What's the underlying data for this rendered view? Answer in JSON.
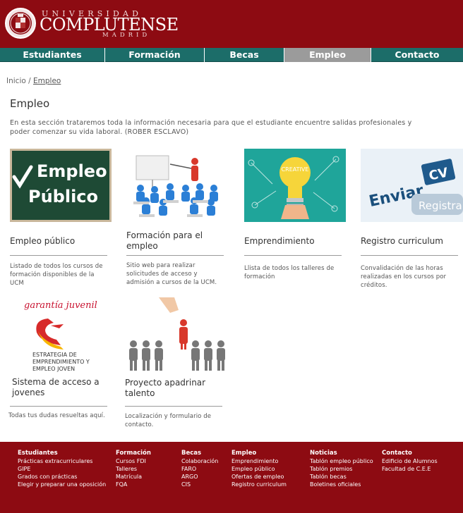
{
  "brand": {
    "top": "UNIVERSIDAD",
    "main": "COMPLUTENSE",
    "bottom": "MADRID"
  },
  "nav": [
    {
      "label": "Estudiantes",
      "active": false
    },
    {
      "label": "Formación",
      "active": false
    },
    {
      "label": "Becas",
      "active": false
    },
    {
      "label": "Empleo",
      "active": true
    },
    {
      "label": "Contacto",
      "active": false
    }
  ],
  "breadcrumb": {
    "home": "Inicio",
    "sep": "/",
    "current": "Empleo"
  },
  "page": {
    "title": "Empleo",
    "intro": "En esta sección trataremos toda la información necesaria para que el estudiante encuentre salidas profesionales y poder comenzar su vida laboral. (ROBER ESCLAVO)"
  },
  "cards": [
    {
      "title": "Empleo público",
      "desc": "Listado de todos los cursos de formación disponibles de la UCM",
      "img_line1": "Empleo",
      "img_line2": "Público"
    },
    {
      "title": "Formación para el empleo",
      "desc": "Sitio web para realizar solicitudes de acceso y admisión a cursos de la UCM."
    },
    {
      "title": "Emprendimiento",
      "desc": "Llista de todos los talleres de formación",
      "img_text": "CREATIVE"
    },
    {
      "title": "Registro curriculum",
      "desc": "Convalidación de las horas realizadas en los cursos por créditos.",
      "img_text1": "Enviar",
      "img_text2": "CV",
      "img_text3": "Registra"
    },
    {
      "title": "Sistema de acceso a jovenes",
      "desc": "Todas tus dudas resueltas aquí.",
      "img_heading": "garantía juvenil",
      "img_l1": "ESTRATEGIA DE",
      "img_l2": "EMPRENDIMIENTO Y",
      "img_l3": "EMPLEO JOVEN"
    },
    {
      "title": "Proyecto apadrinar talento",
      "desc": "Localización y formulario de contacto."
    }
  ],
  "footer": {
    "columns": [
      {
        "heading": "Estudiantes",
        "links": [
          "Prácticas extracurriculares",
          "GIPE",
          "Grados con prácticas",
          "Elegir y preparar una oposición"
        ]
      },
      {
        "heading": "Formación",
        "links": [
          "Cursos FDI",
          "Talleres",
          "Matrícula",
          "FQA"
        ]
      },
      {
        "heading": "Becas",
        "links": [
          "Colaboración",
          "FARO",
          "ARGO",
          "CIS"
        ]
      },
      {
        "heading": "Empleo",
        "links": [
          "Emprendimiento",
          "Empleo público",
          "Ofertas de empleo",
          "Registro curriculum"
        ]
      },
      {
        "heading": "Noticias",
        "links": [
          "Tablón empleo público",
          "Tablón premios",
          "Tablón becas",
          "Boletines oficiales"
        ]
      },
      {
        "heading": "Contacto",
        "links": [
          "Edificio de Alumnos",
          "Facultad de C.E.E"
        ]
      }
    ]
  },
  "colors": {
    "brand_red": "#8d0b12",
    "nav_teal": "#1c6d69",
    "nav_active": "#9b9b9b"
  }
}
